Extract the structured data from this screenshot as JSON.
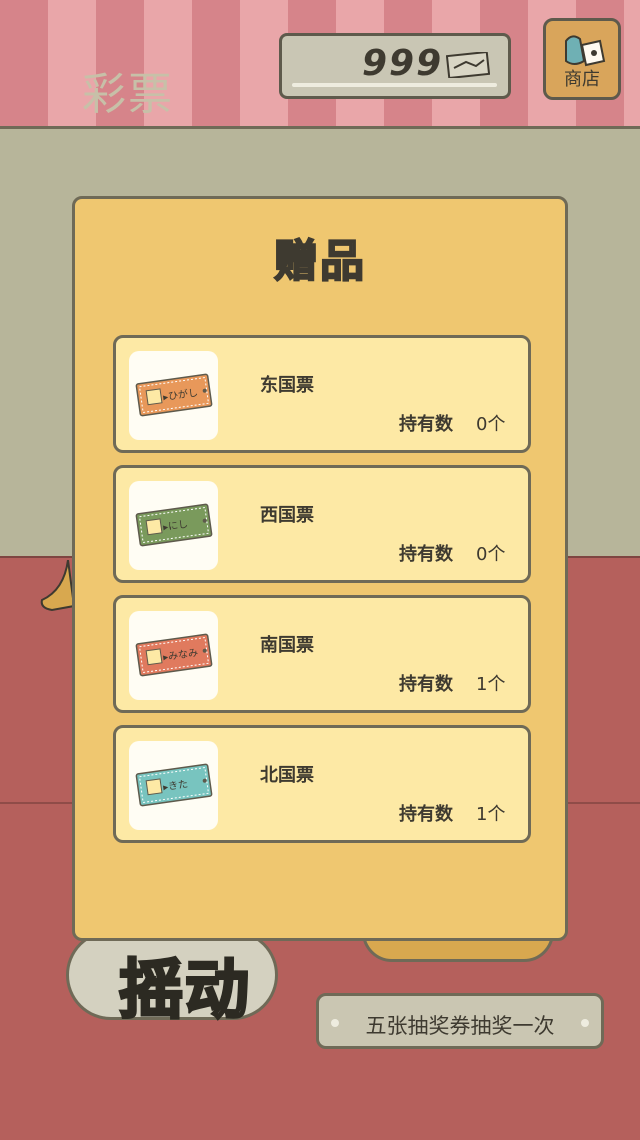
{
  "header": {
    "title": "彩票",
    "ticket_count": "999",
    "shop_label": "商店"
  },
  "popup": {
    "title": "赠品",
    "holding_label": "持有数",
    "items": [
      {
        "name": "东国票",
        "count": "0个",
        "ticket_text": "▸ひがし",
        "ticket_color": "#e8985a",
        "ticket_icon": "ticket-east-icon"
      },
      {
        "name": "西国票",
        "count": "0个",
        "ticket_text": "▸にし",
        "ticket_color": "#7a9a5c",
        "ticket_icon": "ticket-west-icon"
      },
      {
        "name": "南国票",
        "count": "1个",
        "ticket_text": "▸みなみ",
        "ticket_color": "#e07a5e",
        "ticket_icon": "ticket-south-icon"
      },
      {
        "name": "北国票",
        "count": "1个",
        "ticket_text": "▸きた",
        "ticket_color": "#78c4bf",
        "ticket_icon": "ticket-north-icon"
      }
    ]
  },
  "bottom": {
    "shake_label": "摇动",
    "hint": "五张抽奖券抽奖一次"
  },
  "colors": {
    "panel": "#efc770",
    "item_bg": "#fde9a5",
    "floor": "#b5605c",
    "wall": "#b7b59a"
  }
}
